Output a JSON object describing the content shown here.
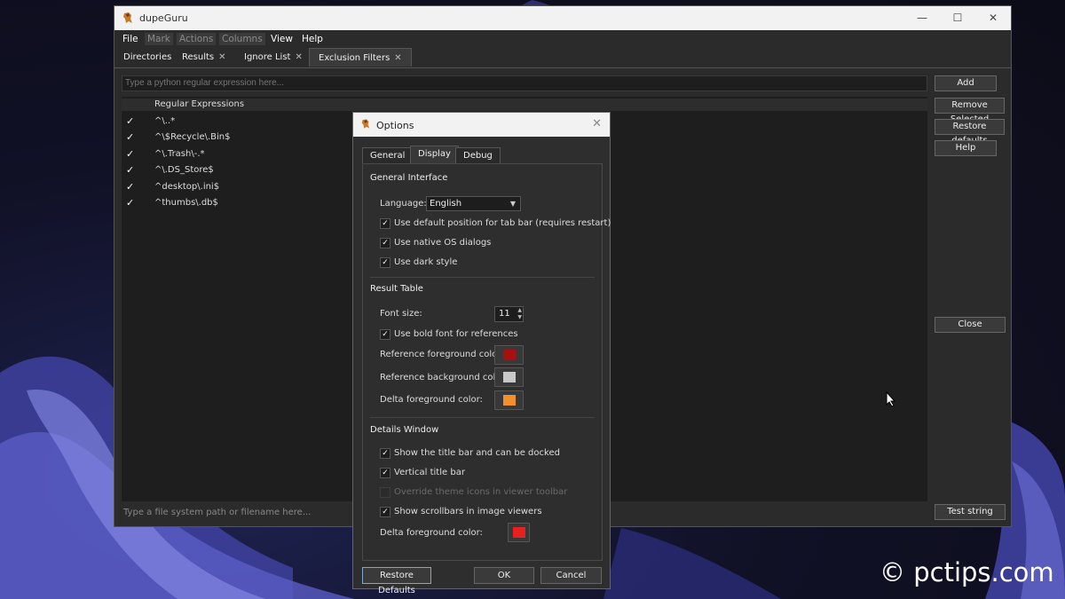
{
  "colors": {
    "window_bg": "#2b2b2b",
    "titlebar_bg": "#f2f2f2",
    "ref_fg_swatch": "#a81010",
    "ref_bg_swatch": "#c8c8c8",
    "delta_fg_swatch_table": "#f0902e",
    "delta_fg_swatch_details": "#e82020"
  },
  "main_window": {
    "title": "dupeGuru",
    "menus": [
      "File",
      "Mark",
      "Actions",
      "Columns",
      "View",
      "Help"
    ],
    "tabs": [
      "Directories",
      "Results",
      "Ignore List",
      "Exclusion Filters"
    ],
    "tab_pin_icon": "pin-icon",
    "regex_placeholder": "Type a python regular expression here...",
    "regex_header": "Regular Expressions",
    "regex_rows": [
      {
        "checked": "✓",
        "text": "^\\..*"
      },
      {
        "checked": "✓",
        "text": "^\\$Recycle\\.Bin$"
      },
      {
        "checked": "✓",
        "text": "^\\.Trash\\-.*"
      },
      {
        "checked": "✓",
        "text": "^\\.DS_Store$"
      },
      {
        "checked": "✓",
        "text": "^desktop\\.ini$"
      },
      {
        "checked": "✓",
        "text": "^thumbs\\.db$"
      }
    ],
    "path_placeholder": "Type a file system path or filename here...",
    "buttons": {
      "add": "Add",
      "remove_selected": "Remove Selected",
      "restore_defaults": "Restore defaults",
      "help": "Help",
      "close": "Close",
      "test_string": "Test string"
    }
  },
  "options_dialog": {
    "title": "Options",
    "tabs": [
      "General",
      "Display",
      "Debug"
    ],
    "active_tab": "Display",
    "general_interface": {
      "title": "General Interface",
      "language_label": "Language:",
      "language_value": "English",
      "checks": [
        {
          "label": "Use default position for tab bar (requires restart)",
          "mark": "✓"
        },
        {
          "label": "Use native OS dialogs",
          "mark": "✓"
        },
        {
          "label": "Use dark style",
          "mark": "✓"
        }
      ]
    },
    "result_table": {
      "title": "Result Table",
      "font_size_label": "Font size:",
      "font_size_value": "11",
      "bold_refs_label": "Use bold font for references",
      "bold_refs_mark": "✓",
      "ref_fg_label": "Reference foreground color:",
      "ref_bg_label": "Reference background color:",
      "delta_fg_label": "Delta foreground color:"
    },
    "details_window": {
      "title": "Details Window",
      "checks": [
        {
          "label": "Show the title bar and can be docked",
          "mark": "✓"
        },
        {
          "label": "Vertical title bar",
          "mark": "✓"
        },
        {
          "label": "Override theme icons in viewer toolbar",
          "mark": ""
        },
        {
          "label": "Show scrollbars in image viewers",
          "mark": "✓"
        }
      ],
      "delta_fg_label": "Delta foreground color:"
    },
    "buttons": {
      "restore_defaults": "Restore Defaults",
      "ok": "OK",
      "cancel": "Cancel"
    }
  },
  "watermark": "© pctips.com"
}
